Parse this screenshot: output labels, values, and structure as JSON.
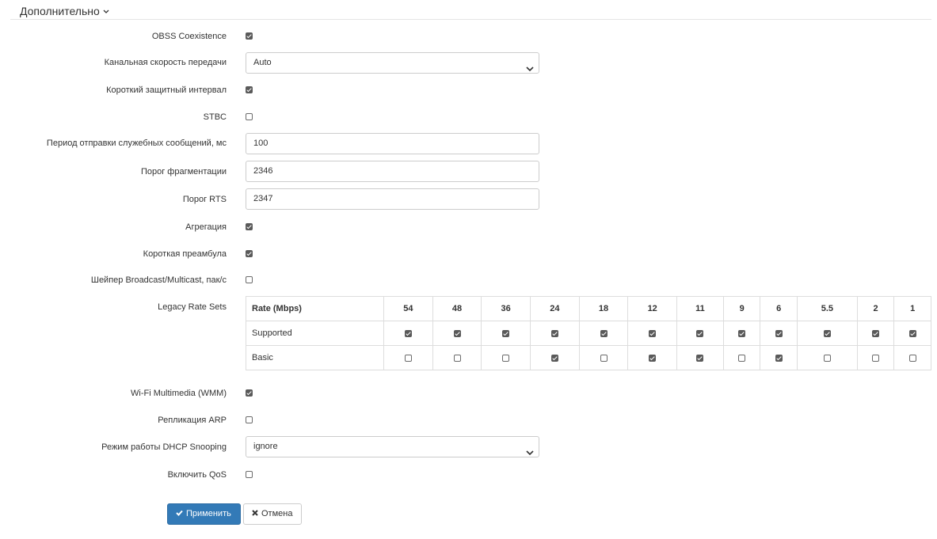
{
  "section": {
    "title": "Дополнительно"
  },
  "fields": {
    "obss": {
      "label": "OBSS Coexistence",
      "checked": true
    },
    "rate": {
      "label": "Канальная скорость передачи",
      "value": "Auto"
    },
    "sgi": {
      "label": "Короткий защитный интервал",
      "checked": true
    },
    "stbc": {
      "label": "STBC",
      "checked": false
    },
    "beacon": {
      "label": "Период отправки служебных сообщений, мс",
      "value": "100"
    },
    "frag": {
      "label": "Порог фрагментации",
      "value": "2346"
    },
    "rts": {
      "label": "Порог RTS",
      "value": "2347"
    },
    "aggr": {
      "label": "Агрегация",
      "checked": true
    },
    "preamble": {
      "label": "Короткая преамбула",
      "checked": true
    },
    "shaper": {
      "label": "Шейпер Broadcast/Multicast, пак/с",
      "checked": false
    },
    "legacy": {
      "label": "Legacy Rate Sets"
    },
    "wmm": {
      "label": "Wi-Fi Multimedia (WMM)",
      "checked": true
    },
    "arp": {
      "label": "Репликация ARP",
      "checked": false
    },
    "dhcp": {
      "label": "Режим работы DHCP Snooping",
      "value": "ignore"
    },
    "qos": {
      "label": "Включить QoS",
      "checked": false
    }
  },
  "rates_table": {
    "header": "Rate (Mbps)",
    "rates": [
      "54",
      "48",
      "36",
      "24",
      "18",
      "12",
      "11",
      "9",
      "6",
      "5.5",
      "2",
      "1"
    ],
    "rows": [
      {
        "label": "Supported",
        "checks": [
          true,
          true,
          true,
          true,
          true,
          true,
          true,
          true,
          true,
          true,
          true,
          true
        ]
      },
      {
        "label": "Basic",
        "checks": [
          false,
          false,
          false,
          true,
          false,
          true,
          true,
          false,
          true,
          false,
          false,
          false
        ]
      }
    ]
  },
  "buttons": {
    "apply": "Применить",
    "cancel": "Отмена"
  },
  "icons": {
    "apply": "check-icon",
    "cancel": "times-icon",
    "select": "chevron-down-icon"
  },
  "colors": {
    "primary": "#337ab7",
    "border": "#cccccc"
  }
}
